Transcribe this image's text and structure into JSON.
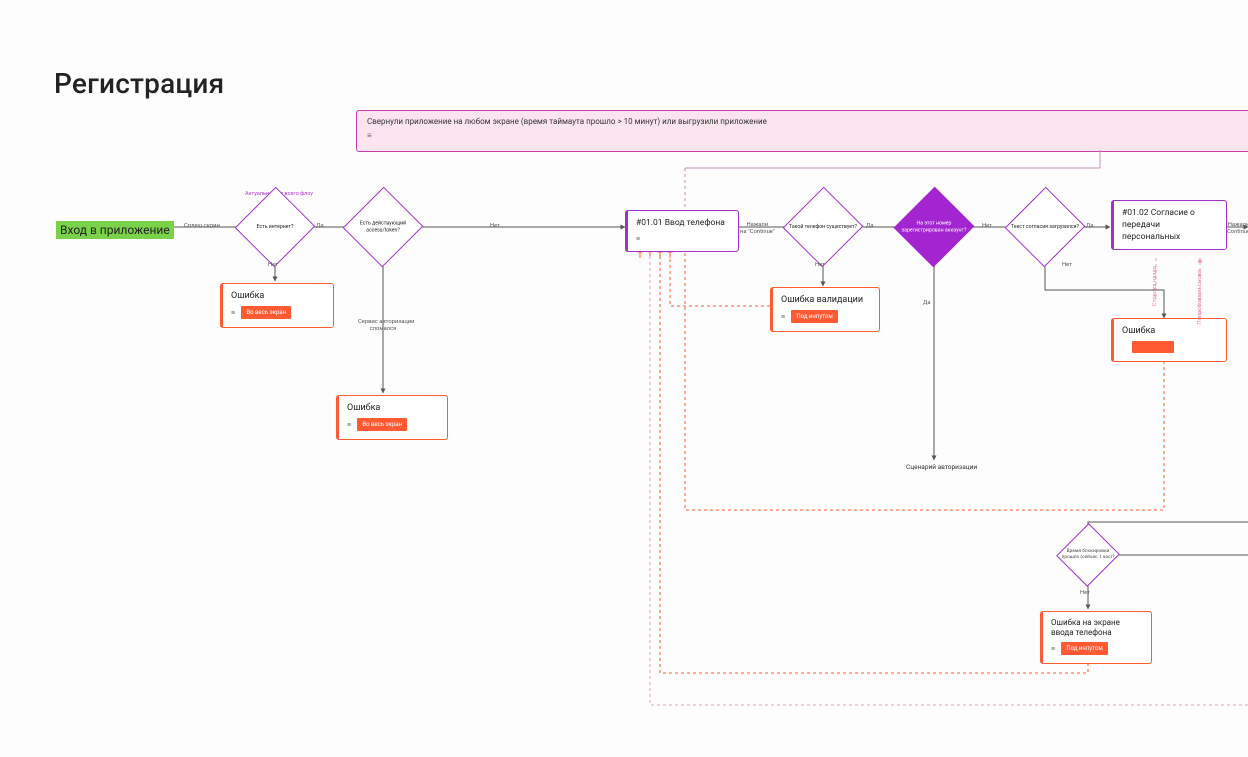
{
  "title": "Регистрация",
  "banner": {
    "text": "Свернули приложение на любом экране (время таймаута прошло > 10 минут) или выгрузили приложение"
  },
  "entry": {
    "label": "Вход в приложение"
  },
  "captions": {
    "above_d1": "Актуально для всего флоу"
  },
  "diamonds": {
    "d1": "Есть интернет?",
    "d2": "Есть действующий access/token?",
    "d3": "Такой телефон существует?",
    "d4": "На этот номер зарегистрирован аккаунт?",
    "d5": "Текст согласия загрузился?",
    "d6": "Время блокировки прошло (сейчас 1 час)?"
  },
  "screens": {
    "s1": "#01.01 Ввод телефона",
    "s2": "#01.02 Согласие о передачи персональных"
  },
  "errors": {
    "e1": {
      "title": "Ошибка",
      "tag": "Во весь экран"
    },
    "e2": {
      "title": "Ошибка",
      "tag": "Во весь экран"
    },
    "e3": {
      "title": "Ошибка валидации",
      "tag": "Под инпутом"
    },
    "e4": {
      "title": "Ошибка",
      "tag": ""
    },
    "e5": {
      "title": "Ошибка на экране ввода телефона",
      "tag": "Под инпутом"
    }
  },
  "labels": {
    "splash": "Сплеш скрин",
    "da": "Да",
    "net": "Нет",
    "continue": "Нажали\nна \"Continue\"",
    "continue2": "Нажали\nContinue",
    "auth_broken": "Сервис авторизации\nсломался",
    "auth_scenario": "Сценарий авторизации",
    "retry": "Попробовали снова",
    "back": "Стрелка назад"
  }
}
